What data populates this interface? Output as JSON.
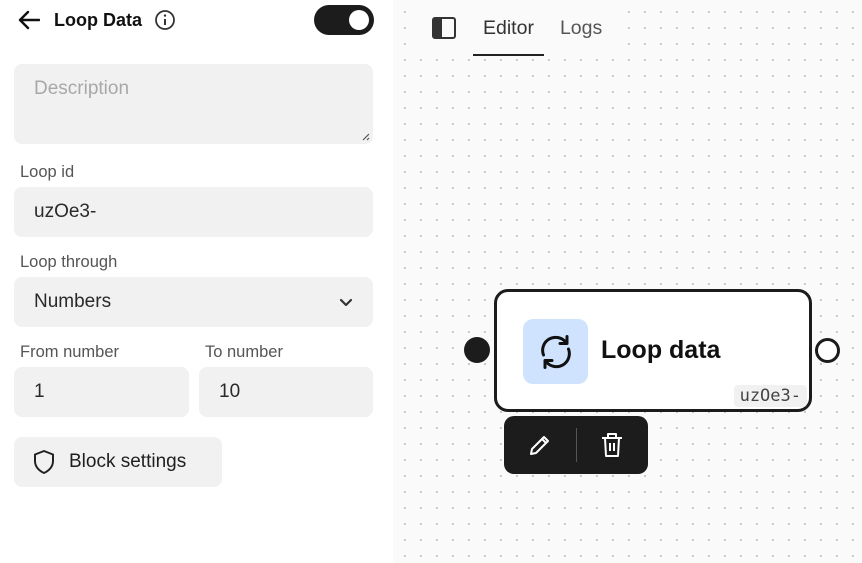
{
  "panel": {
    "title": "Loop Data",
    "enabled": true,
    "description": {
      "placeholder": "Description",
      "value": ""
    },
    "loop_id": {
      "label": "Loop id",
      "value": "uzOe3-"
    },
    "loop_through": {
      "label": "Loop through",
      "value": "Numbers"
    },
    "from_number": {
      "label": "From number",
      "value": "1"
    },
    "to_number": {
      "label": "To number",
      "value": "10"
    },
    "block_settings_label": "Block settings"
  },
  "canvas": {
    "tabs": [
      {
        "label": "Editor",
        "active": true
      },
      {
        "label": "Logs",
        "active": false
      }
    ],
    "node": {
      "title": "Loop data",
      "id": "uzOe3-",
      "icon": "refresh-icon",
      "icon_bg": "#cfe3ff"
    }
  },
  "colors": {
    "dark": "#1c1c1c",
    "field_bg": "#f1f1f1"
  }
}
